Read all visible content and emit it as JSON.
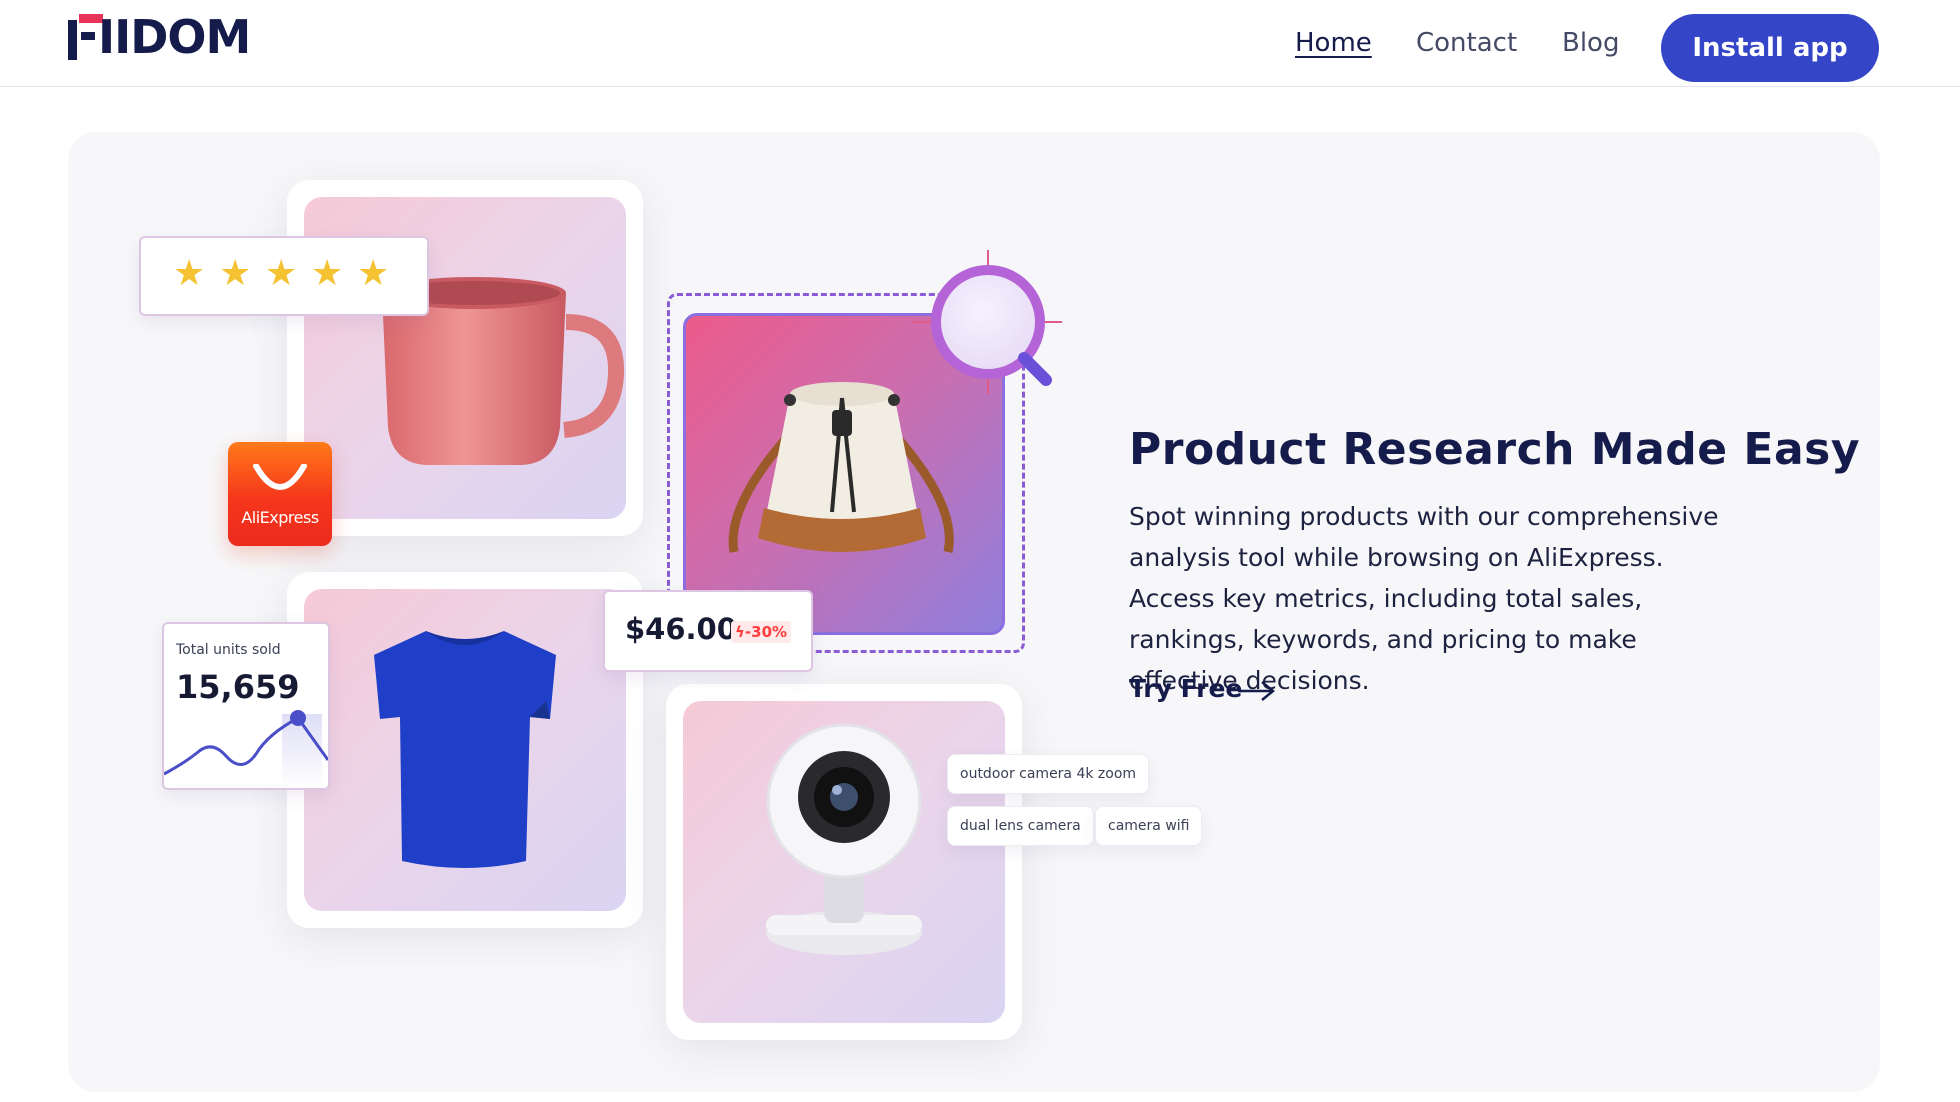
{
  "brand": {
    "name": "IIDOM",
    "accent": "#e8335a",
    "navy": "#151b4a"
  },
  "nav": {
    "links": [
      {
        "label": "Home",
        "active": true
      },
      {
        "label": "Contact",
        "active": false
      },
      {
        "label": "Blog",
        "active": false
      }
    ],
    "cta_label": "Install app",
    "cta_color": "#3545c7"
  },
  "hero": {
    "title": "Product Research Made Easy",
    "description": "Spot winning products with our comprehensive analysis tool while browsing on AliExpress. Access key metrics, including total sales, rankings, keywords, and pricing to make effective decisions.",
    "cta_label": "Try Free",
    "cta_icon": "arrow-right-icon"
  },
  "illustration": {
    "rating_stars": 5,
    "marketplace_badge": "AliExpress",
    "units_sold": {
      "label": "Total units sold",
      "value": "15,659"
    },
    "price": {
      "value": "$46.00",
      "discount": "-30%"
    },
    "keywords": [
      "outdoor camera 4k zoom",
      "dual lens camera",
      "camera wifi"
    ],
    "products": [
      "mug",
      "bucket-bag",
      "t-shirt",
      "security-camera"
    ],
    "colors": {
      "star": "#f5c232",
      "aliexpress": "#f5361b",
      "chart_line": "#4a4fc9",
      "dash": "#8a5bd6"
    }
  }
}
